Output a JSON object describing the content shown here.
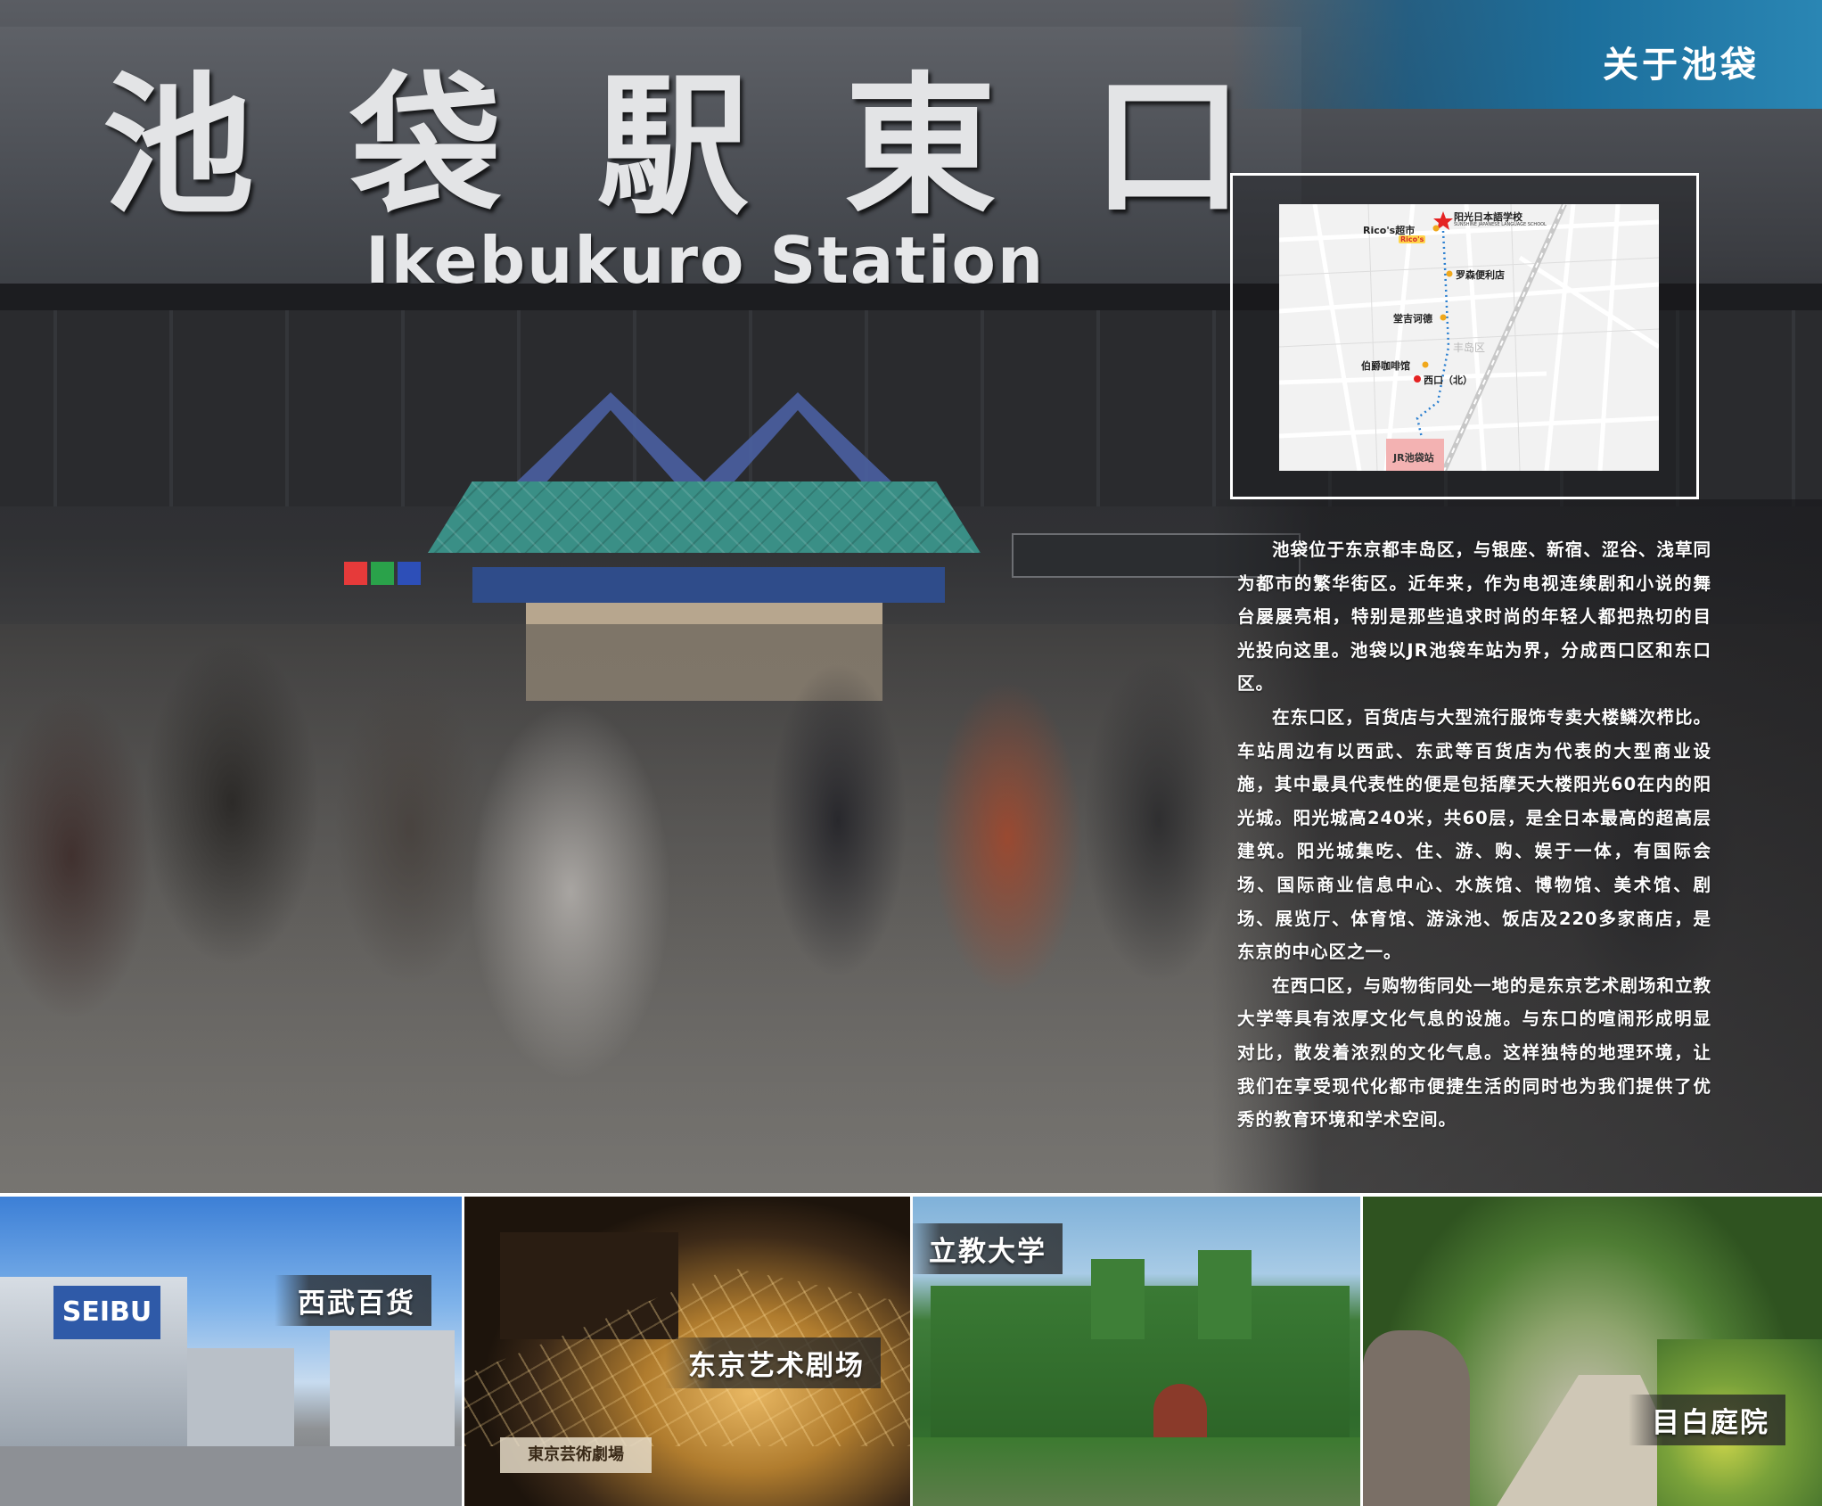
{
  "hero": {
    "sign_kanji": [
      "池",
      "袋",
      "駅",
      "東",
      "口"
    ],
    "sign_english": "Ikebukuro Station"
  },
  "title": "关于池袋",
  "map": {
    "destination": "阳光日本語学校",
    "destination_en": "SUNSHINE JAPANESE LANGUAGE SCHOOL",
    "rico_label": "Rico's超市",
    "rico_logo": "Rico's",
    "lawson": "罗森便利店",
    "donki": "堂吉诃德",
    "cafe": "伯爵咖啡馆",
    "district": "丰岛区",
    "west_exit": "西口（北）",
    "station": "JR池袋站",
    "colors": {
      "route": "#2a7fd0",
      "poi": "#f0a81c",
      "star": "#e52222",
      "station": "#f3b2b2"
    }
  },
  "body": {
    "paragraphs": [
      "池袋位于东京都丰岛区，与银座、新宿、涩谷、浅草同为都市的繁华街区。近年来，作为电视连续剧和小说的舞台屡屡亮相，特别是那些追求时尚的年轻人都把热切的目光投向这里。池袋以JR池袋车站为界，分成西口区和东口区。",
      "在东口区，百货店与大型流行服饰专卖大楼鳞次栉比。车站周边有以西武、东武等百货店为代表的大型商业设施，其中最具代表性的便是包括摩天大楼阳光60在内的阳光城。阳光城高240米，共60层，是全日本最高的超高层建筑。阳光城集吃、住、游、购、娱于一体，有国际会场、国际商业信息中心、水族馆、博物馆、美术馆、剧场、展览厅、体育馆、游泳池、饭店及220多家商店，是东京的中心区之一。",
      "在西口区，与购物街同处一地的是东京艺术剧场和立教大学等具有浓厚文化气息的设施。与东口的喧闹形成明显对比，散发着浓烈的文化气息。这样独特的地理环境，让我们在享受现代化都市便捷生活的同时也为我们提供了优秀的教育环境和学术空间。"
    ]
  },
  "thumbnails": [
    {
      "label": "西武百货",
      "sign": "SEIBU"
    },
    {
      "label": "东京艺术剧场",
      "sign": "東京芸術劇場"
    },
    {
      "label": "立教大学"
    },
    {
      "label": "目白庭院"
    }
  ]
}
